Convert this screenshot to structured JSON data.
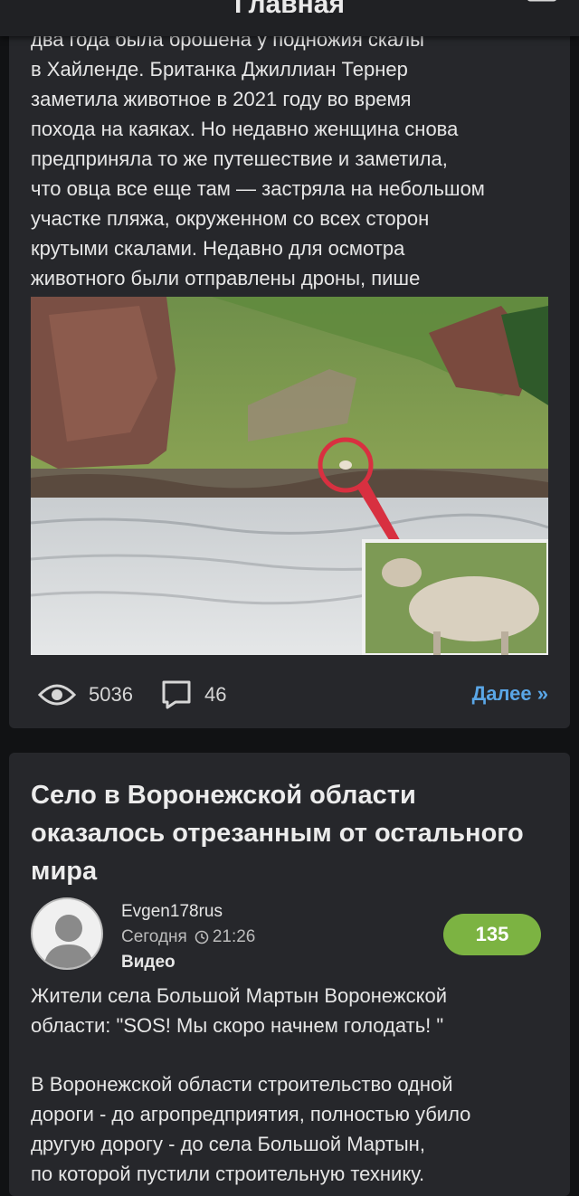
{
  "header": {
    "title": "Главная"
  },
  "article1": {
    "text_lines": [
      "два года была брошена у подножия скалы",
      "в Хайленде. Британка Джиллиан Тернер",
      "заметила животное в 2021 году во время",
      "похода на каяках. Но недавно женщина снова",
      "предприняла то же путешествие и заметила,",
      "что овца все еще там — застряла на небольшом",
      "участке пляжа, окруженном со всех сторон",
      "крутыми скалами. Недавно для осмотра",
      "животного были отправлены дроны, пише"
    ],
    "image_icon": "photo-sheep-on-beach",
    "views": "5036",
    "comments": "46",
    "more_label": "Далее »"
  },
  "article2": {
    "title": "Село в Воронежской области оказалось отрезанным от остального мира",
    "author": "Evgen178rus",
    "date": "Сегодня",
    "time": "21:26",
    "category": "Видео",
    "rating": "135",
    "paragraph1_lines": [
      "Жители села Большой Мартын Воронежской",
      "области: \"SOS! Мы скоро начнем голодать! \""
    ],
    "paragraph2_lines": [
      "В Воронежской области строительство одной",
      "дороги - до агропредприятия, полностью убило",
      "другую дорогу - до села Большой Мартын,",
      "по которой пустили строительную технику."
    ]
  },
  "colors": {
    "background": "#111214",
    "card": "#26272b",
    "link": "#5aa6e6",
    "rating_badge": "#7cb342"
  }
}
